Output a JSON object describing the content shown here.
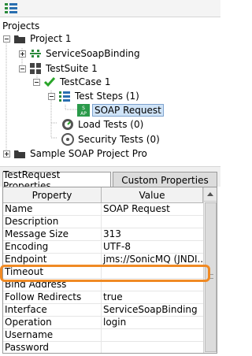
{
  "toolbar": {
    "icon": "list-tree-icon"
  },
  "tree": {
    "header": "Projects",
    "nodes": [
      {
        "label": "Project 1",
        "icon": "folder-icon"
      },
      {
        "label": "ServiceSoapBinding",
        "icon": "interface-icon"
      },
      {
        "label": "TestSuite 1",
        "icon": "testsuite-grid-icon"
      },
      {
        "label": "TestCase 1",
        "icon": "check-icon"
      },
      {
        "label": "Test Steps (1)",
        "icon": "list-icon"
      },
      {
        "label": "SOAP Request",
        "icon": "soap-request-icon"
      },
      {
        "label": "Load Tests (0)",
        "icon": "gauge-icon"
      },
      {
        "label": "Security Tests (0)",
        "icon": "security-icon"
      },
      {
        "label": "Sample SOAP Project Pro",
        "icon": "folder-icon"
      }
    ]
  },
  "tabs": [
    {
      "label": "TestRequest Properties"
    },
    {
      "label": "Custom Properties"
    }
  ],
  "table": {
    "headers": {
      "property": "Property",
      "value": "Value"
    },
    "rows": [
      {
        "name": "Name",
        "value": "SOAP Request"
      },
      {
        "name": "Description",
        "value": ""
      },
      {
        "name": "Message Size",
        "value": "313"
      },
      {
        "name": "Encoding",
        "value": "UTF-8"
      },
      {
        "name": "Endpoint",
        "value": "jms://SonicMQ (JNDI..."
      },
      {
        "name": "Timeout",
        "value": ""
      },
      {
        "name": "Bind Address",
        "value": ""
      },
      {
        "name": "Follow Redirects",
        "value": "true"
      },
      {
        "name": "Interface",
        "value": "ServiceSoapBinding"
      },
      {
        "name": "Operation",
        "value": "login"
      },
      {
        "name": "Username",
        "value": ""
      },
      {
        "name": "Password",
        "value": ""
      }
    ]
  },
  "colors": {
    "highlight": "#f08a24",
    "selection": "#cfe3f7",
    "check": "#2aa52a"
  }
}
